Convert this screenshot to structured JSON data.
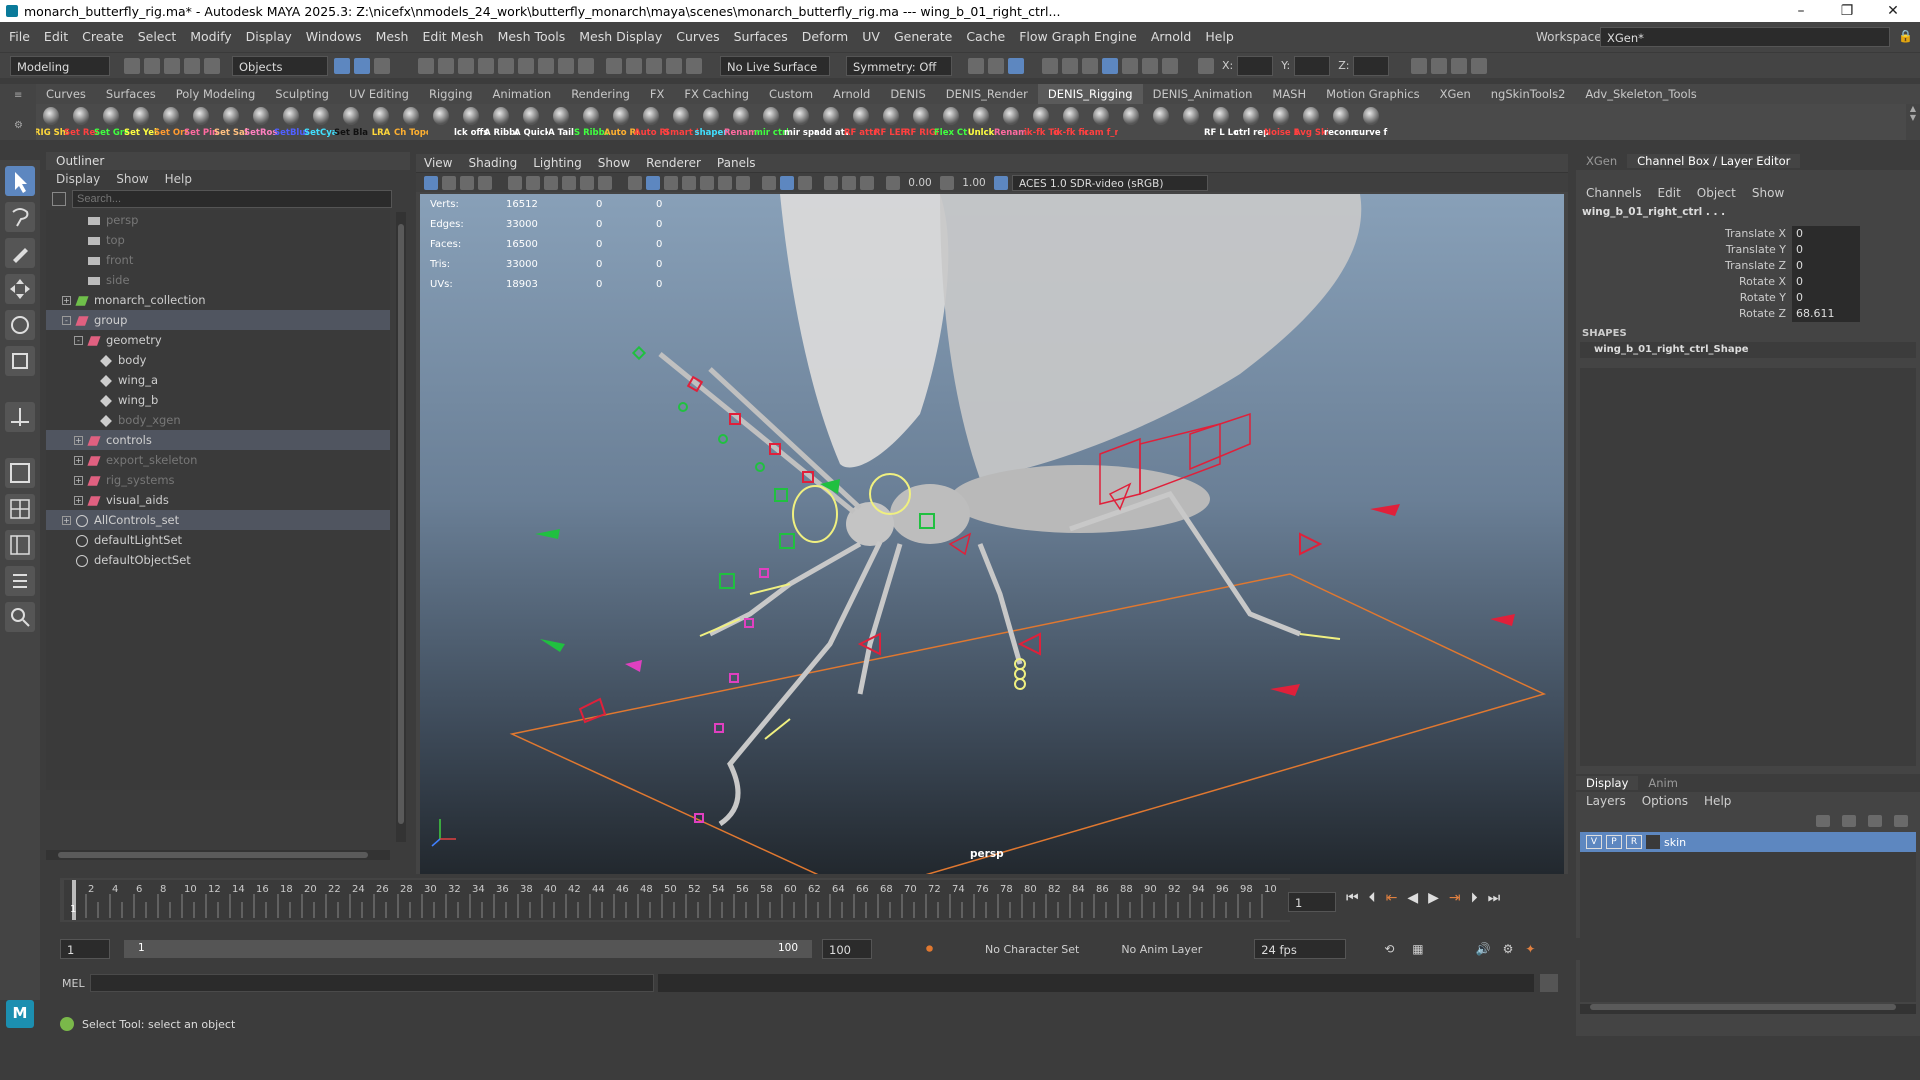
{
  "window": {
    "title": "monarch_butterfly_rig.ma* - Autodesk MAYA 2025.3: Z:\\nicefx\\nmodels_24_work\\butterfly_monarch\\maya\\scenes\\monarch_butterfly_rig.ma  ---  wing_b_01_right_ctrl...",
    "controls": [
      "–",
      "❐",
      "✕"
    ]
  },
  "menubar": {
    "items": [
      "File",
      "Edit",
      "Create",
      "Select",
      "Modify",
      "Display",
      "Windows",
      "Mesh",
      "Edit Mesh",
      "Mesh Tools",
      "Mesh Display",
      "Curves",
      "Surfaces",
      "Deform",
      "UV",
      "Generate",
      "Cache",
      "Flow Graph Engine",
      "Arnold",
      "Help"
    ],
    "workspace_label": "Workspace:",
    "workspace_value": "XGen*"
  },
  "toolbar": {
    "mode": "Modeling",
    "objects": "Objects",
    "live_surface": "No Live Surface",
    "symmetry": "Symmetry: Off",
    "x_label": "X:",
    "y_label": "Y:",
    "z_label": "Z:"
  },
  "shelf": {
    "tabs": [
      "Curves",
      "Surfaces",
      "Poly Modeling",
      "Sculpting",
      "UV Editing",
      "Rigging",
      "Animation",
      "Rendering",
      "FX",
      "FX Caching",
      "Custom",
      "Arnold",
      "DENIS",
      "DENIS_Render",
      "DENIS_Rigging",
      "DENIS_Animation",
      "MASH",
      "Motion Graphics",
      "XGen",
      "ngSkinTools2",
      "Adv_Skeleton_Tools"
    ],
    "active_tab": "DENIS_Rigging",
    "buttons": [
      {
        "label": "RIG Sha",
        "color": "#ffd83a"
      },
      {
        "label": "Set Red",
        "color": "#ff4040"
      },
      {
        "label": "Set Gre",
        "color": "#40ff40"
      },
      {
        "label": "Set Yell",
        "color": "#ffff40"
      },
      {
        "label": "Set Ora",
        "color": "#ff9a30"
      },
      {
        "label": "Set Pin",
        "color": "#ff6aa0"
      },
      {
        "label": "Set Sale",
        "color": "#ffc080"
      },
      {
        "label": "SetRose",
        "color": "#ff80c0"
      },
      {
        "label": "SetBlue",
        "color": "#5060ff"
      },
      {
        "label": "SetCyan",
        "color": "#40e0ff"
      },
      {
        "label": "Set Blac",
        "color": "#111111"
      },
      {
        "label": "LRA",
        "color": "#ffd83a"
      },
      {
        "label": "Ch Topo",
        "color": "#ffb030"
      },
      {
        "label": "",
        "color": "#ffffff"
      },
      {
        "label": "lck offse",
        "color": "#ffffff"
      },
      {
        "label": "A Ribbo",
        "color": "#ffffff"
      },
      {
        "label": "A Quick",
        "color": "#ffffff"
      },
      {
        "label": "A Tail",
        "color": "#ffffff"
      },
      {
        "label": "S Ribbo",
        "color": "#40ff40"
      },
      {
        "label": "Auto RIG",
        "color": "#ffb030"
      },
      {
        "label": "Auto RIG",
        "color": "#ff4040"
      },
      {
        "label": "Smart Eye RIG",
        "color": "#ff4040"
      },
      {
        "label": "shaper",
        "color": "#40e0ff"
      },
      {
        "label": "Rename",
        "color": "#ff6aa0"
      },
      {
        "label": "mir ctrl",
        "color": "#40ff40"
      },
      {
        "label": "mir spr",
        "color": "#ffffff"
      },
      {
        "label": "add at2",
        "color": "#ffffff"
      },
      {
        "label": "RF attri",
        "color": "#ff4040"
      },
      {
        "label": "RF LEFT",
        "color": "#ff4040"
      },
      {
        "label": "RF RIGH",
        "color": "#ff4040"
      },
      {
        "label": "Flex Ctr",
        "color": "#40ff40"
      },
      {
        "label": "Unlck",
        "color": "#ffff40"
      },
      {
        "label": "Rename",
        "color": "#ff6aa0"
      },
      {
        "label": "ik-fk To",
        "color": "#ff4040"
      },
      {
        "label": "ik-fk fin",
        "color": "#ff4040"
      },
      {
        "label": "cam f_ri",
        "color": "#ff4040"
      },
      {
        "label": "",
        "color": "#ffffff"
      },
      {
        "label": "",
        "color": "#ffffff"
      },
      {
        "label": "",
        "color": "#ffffff"
      },
      {
        "label": "RF L Lo",
        "color": "#ffffff"
      },
      {
        "label": "ctrl rep",
        "color": "#ffffff"
      },
      {
        "label": "Noise E",
        "color": "#ff4040"
      },
      {
        "label": "Avg Ski",
        "color": "#ff4040"
      },
      {
        "label": "reconne",
        "color": "#ffffff"
      },
      {
        "label": "curve fr",
        "color": "#ffffff"
      }
    ]
  },
  "outliner": {
    "title": "Outliner",
    "menu": [
      "Display",
      "Show",
      "Help"
    ],
    "search_placeholder": "Search...",
    "items": [
      {
        "label": "persp",
        "indent": 1,
        "icon": "camera-icon",
        "dim": true,
        "exp": ""
      },
      {
        "label": "top",
        "indent": 1,
        "icon": "camera-icon",
        "dim": true,
        "exp": ""
      },
      {
        "label": "front",
        "indent": 1,
        "icon": "camera-icon",
        "dim": true,
        "exp": ""
      },
      {
        "label": "side",
        "indent": 1,
        "icon": "camera-icon",
        "dim": true,
        "exp": ""
      },
      {
        "label": "monarch_collection",
        "indent": 0,
        "icon": "collection-icon",
        "dim": false,
        "exp": "+"
      },
      {
        "label": "group",
        "indent": 0,
        "icon": "group-icon",
        "dim": false,
        "exp": "-",
        "hl": true
      },
      {
        "label": "geometry",
        "indent": 1,
        "icon": "group-icon",
        "dim": false,
        "exp": "-"
      },
      {
        "label": "body",
        "indent": 2,
        "icon": "mesh-icon",
        "dim": false,
        "exp": ""
      },
      {
        "label": "wing_a",
        "indent": 2,
        "icon": "mesh-icon",
        "dim": false,
        "exp": ""
      },
      {
        "label": "wing_b",
        "indent": 2,
        "icon": "mesh-icon",
        "dim": false,
        "exp": ""
      },
      {
        "label": "body_xgen",
        "indent": 2,
        "icon": "mesh-icon",
        "dim": true,
        "exp": ""
      },
      {
        "label": "controls",
        "indent": 1,
        "icon": "group-icon",
        "dim": false,
        "exp": "+",
        "hl": true
      },
      {
        "label": "export_skeleton",
        "indent": 1,
        "icon": "group-icon",
        "dim": true,
        "exp": "+"
      },
      {
        "label": "rig_systems",
        "indent": 1,
        "icon": "group-icon",
        "dim": true,
        "exp": "+"
      },
      {
        "label": "visual_aids",
        "indent": 1,
        "icon": "group-icon",
        "dim": false,
        "exp": "+"
      },
      {
        "label": "AllControls_set",
        "indent": 0,
        "icon": "set-icon",
        "dim": false,
        "exp": "+",
        "hl": true
      },
      {
        "label": "defaultLightSet",
        "indent": 0,
        "icon": "set-icon",
        "dim": false,
        "exp": ""
      },
      {
        "label": "defaultObjectSet",
        "indent": 0,
        "icon": "set-icon",
        "dim": false,
        "exp": ""
      }
    ]
  },
  "viewport": {
    "menu": [
      "View",
      "Shading",
      "Lighting",
      "Show",
      "Renderer",
      "Panels"
    ],
    "exposure": "0.00",
    "gamma": "1.00",
    "color_space": "ACES 1.0 SDR-video (sRGB)",
    "camera_label": "persp",
    "hud": [
      {
        "k": "Verts:",
        "a": "16512",
        "b": "0",
        "c": "0"
      },
      {
        "k": "Edges:",
        "a": "33000",
        "b": "0",
        "c": "0"
      },
      {
        "k": "Faces:",
        "a": "16500",
        "b": "0",
        "c": "0"
      },
      {
        "k": "Tris:",
        "a": "33000",
        "b": "0",
        "c": "0"
      },
      {
        "k": "UVs:",
        "a": "18903",
        "b": "0",
        "c": "0"
      }
    ]
  },
  "channelbox": {
    "tabs": [
      "XGen",
      "Channel Box / Layer Editor"
    ],
    "menu": [
      "Channels",
      "Edit",
      "Object",
      "Show"
    ],
    "object_name": "wing_b_01_right_ctrl . . .",
    "channels": [
      {
        "name": "Translate X",
        "value": "0"
      },
      {
        "name": "Translate Y",
        "value": "0"
      },
      {
        "name": "Translate Z",
        "value": "0"
      },
      {
        "name": "Rotate X",
        "value": "0"
      },
      {
        "name": "Rotate Y",
        "value": "0"
      },
      {
        "name": "Rotate Z",
        "value": "68.611"
      }
    ],
    "shapes_label": "SHAPES",
    "shape_name": "wing_b_01_right_ctrl_Shape"
  },
  "layers": {
    "tabs": [
      "Display",
      "Anim"
    ],
    "menu": [
      "Layers",
      "Options",
      "Help"
    ],
    "layer": {
      "v": "V",
      "p": "P",
      "r": "R",
      "name": "skin"
    }
  },
  "timeline": {
    "ticks": [
      "2",
      "4",
      "6",
      "8",
      "10",
      "12",
      "14",
      "16",
      "18",
      "20",
      "22",
      "24",
      "26",
      "28",
      "30",
      "32",
      "34",
      "36",
      "38",
      "40",
      "42",
      "44",
      "46",
      "48",
      "50",
      "52",
      "54",
      "56",
      "58",
      "60",
      "62",
      "64",
      "66",
      "68",
      "70",
      "72",
      "74",
      "76",
      "78",
      "80",
      "82",
      "84",
      "86",
      "88",
      "90",
      "92",
      "94",
      "96",
      "98",
      "10"
    ],
    "start_frame": "1",
    "current_frame": "1"
  },
  "range": {
    "start": "1",
    "inner_start": "1",
    "inner_end": "100",
    "end": "100",
    "character_set": "No Character Set",
    "anim_layer": "No Anim Layer",
    "fps": "24 fps"
  },
  "mel": {
    "label": "MEL"
  },
  "help": {
    "text": "Select Tool: select an object"
  },
  "colors": {
    "accent": "#5d87c0",
    "control_red": "#e0203a",
    "control_green": "#20c040",
    "control_yellow": "#f0f080",
    "control_pink": "#e040c0",
    "grid_orange": "#e07830"
  }
}
